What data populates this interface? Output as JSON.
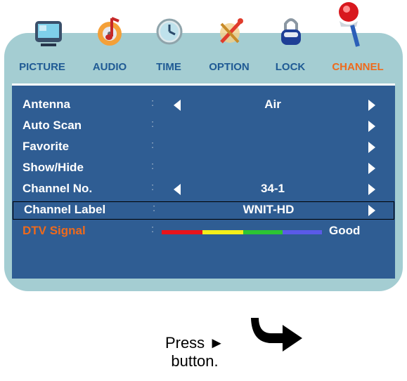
{
  "tabs": [
    {
      "label": "PICTURE",
      "icon": "tv-picture-icon"
    },
    {
      "label": "AUDIO",
      "icon": "music-note-icon"
    },
    {
      "label": "TIME",
      "icon": "clock-icon"
    },
    {
      "label": "OPTION",
      "icon": "wrench-screwdriver-icon"
    },
    {
      "label": "LOCK",
      "icon": "padlock-icon"
    },
    {
      "label": "CHANNEL",
      "icon": "magnifier-icon",
      "active": true
    }
  ],
  "menu": {
    "rows": [
      {
        "label": "Antenna",
        "colon": ":",
        "value": "Air"
      },
      {
        "label": "Auto Scan",
        "colon": ":"
      },
      {
        "label": "Favorite",
        "colon": ":"
      },
      {
        "label": "Show/Hide",
        "colon": ":"
      },
      {
        "label": "Channel No.",
        "colon": ":",
        "value": "34-1"
      },
      {
        "label": "Channel Label",
        "colon": ":",
        "value": "WNIT-HD"
      },
      {
        "label": "DTV Signal",
        "colon": ":",
        "value": "Good"
      }
    ],
    "selected_row": "Channel Label",
    "signal_colors": [
      "#e8141c",
      "#f4ee1a",
      "#2cc434",
      "#5a5ae8"
    ]
  },
  "footer": {
    "line1": "Press ►",
    "line2": "button."
  },
  "colors": {
    "panel": "#2f5d93",
    "frame": "#a4cdd2",
    "active_tab": "#ee6a1c",
    "tab_text": "#1f5a94"
  }
}
